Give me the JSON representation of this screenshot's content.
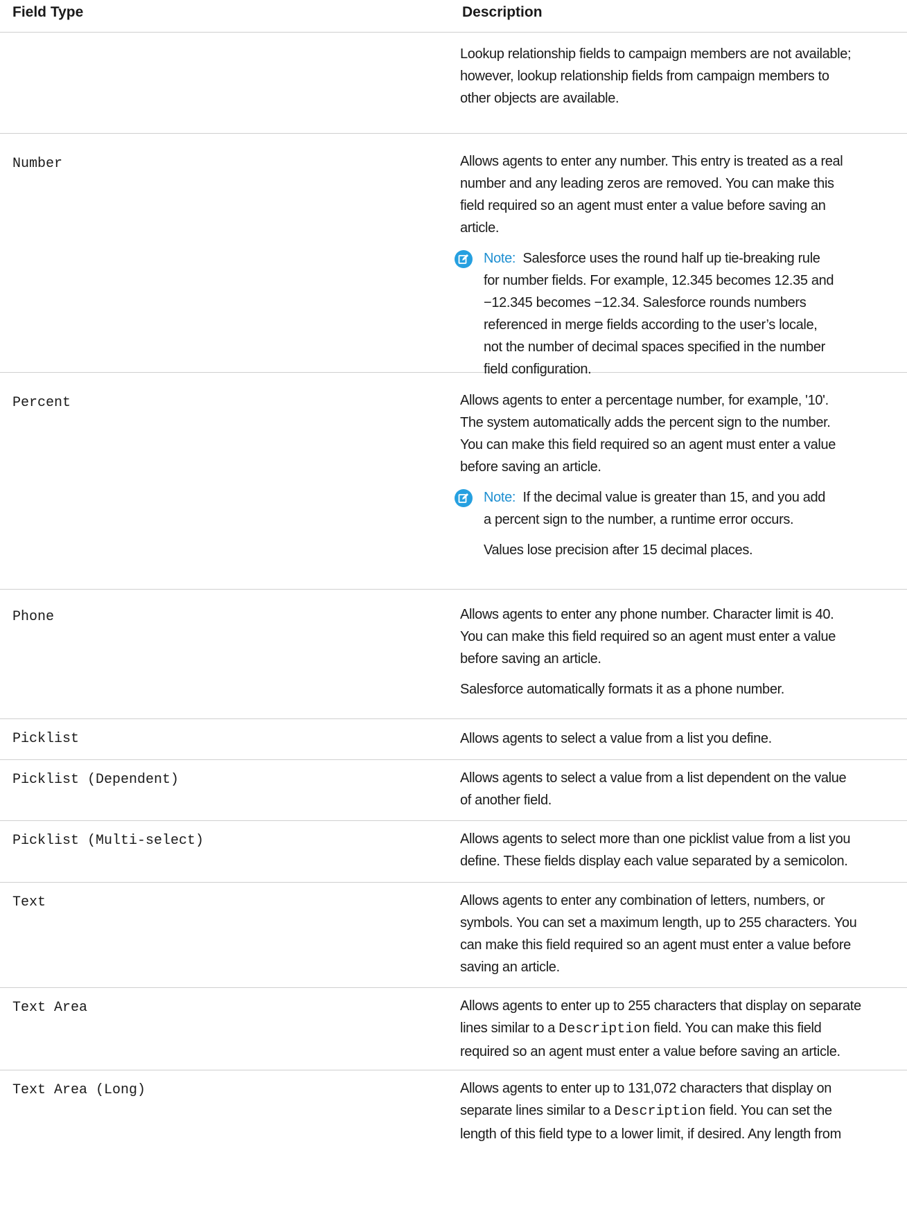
{
  "table": {
    "headers": {
      "field_type": "Field Type",
      "description": "Description"
    },
    "row0": {
      "p1": [
        "Lookup relationship fields to campaign members are not available;",
        "however, lookup relationship fields from campaign members to",
        "other objects are available."
      ]
    },
    "row_number": {
      "type": "Number",
      "p1": [
        "Allows agents to enter any number. This entry is treated as a real",
        "number and any leading zeros are removed. You can make this",
        "field required so an agent must enter a value before saving an",
        "article."
      ],
      "note_label": "Note:",
      "note": [
        "Salesforce uses the round half up tie-breaking rule",
        "for number fields. For example, 12.345 becomes 12.35 and",
        "−12.345 becomes −12.34. Salesforce rounds numbers",
        "referenced in merge fields according to the user’s locale,",
        "not the number of decimal spaces specified in the number",
        "field configuration."
      ]
    },
    "row_percent": {
      "type": "Percent",
      "p1": [
        "Allows agents to enter a percentage number, for example, '10'.",
        "The system automatically adds the percent sign to the number.",
        "You can make this field required so an agent must enter a value",
        "before saving an article."
      ],
      "note_label": "Note:",
      "note": [
        "If the decimal value is greater than 15, and you add",
        "a percent sign to the number, a runtime error occurs."
      ],
      "note2": "Values lose precision after 15 decimal places."
    },
    "row_phone": {
      "type": "Phone",
      "p1": [
        "Allows agents to enter any phone number. Character limit is 40.",
        "You can make this field required so an agent must enter a value",
        "before saving an article."
      ],
      "p2": "Salesforce automatically formats it as a phone number."
    },
    "row_picklist": {
      "type": "Picklist",
      "p1": "Allows agents to select a value from a list you define."
    },
    "row_picklist_dep": {
      "type": "Picklist (Dependent)",
      "p1": [
        "Allows agents to select a value from a list dependent on the value",
        "of another field."
      ]
    },
    "row_picklist_multi": {
      "type": "Picklist (Multi-select)",
      "p1": [
        "Allows agents to select more than one picklist value from a list you",
        "define. These fields display each value separated by a semicolon."
      ]
    },
    "row_text": {
      "type": "Text",
      "p1": [
        "Allows agents to enter any combination of letters, numbers, or",
        "symbols. You can set a maximum length, up to 255 characters. You",
        "can make this field required so an agent must enter a value before",
        "saving an article."
      ]
    },
    "row_textarea": {
      "type": "Text Area",
      "l1": "Allows agents to enter up to 255 characters that display on separate",
      "l2a": "lines similar to a ",
      "l2code": "Description",
      "l2b": " field. You can make this field",
      "l3": "required so an agent must enter a value before saving an article."
    },
    "row_textarea_long": {
      "type": "Text Area (Long)",
      "l1": "Allows agents to enter up to 131,072 characters that display on",
      "l2a": "separate lines similar to a ",
      "l2code": "Description",
      "l2b": " field. You can set the",
      "l3": "length of this field type to a lower limit, if desired. Any length from"
    }
  }
}
